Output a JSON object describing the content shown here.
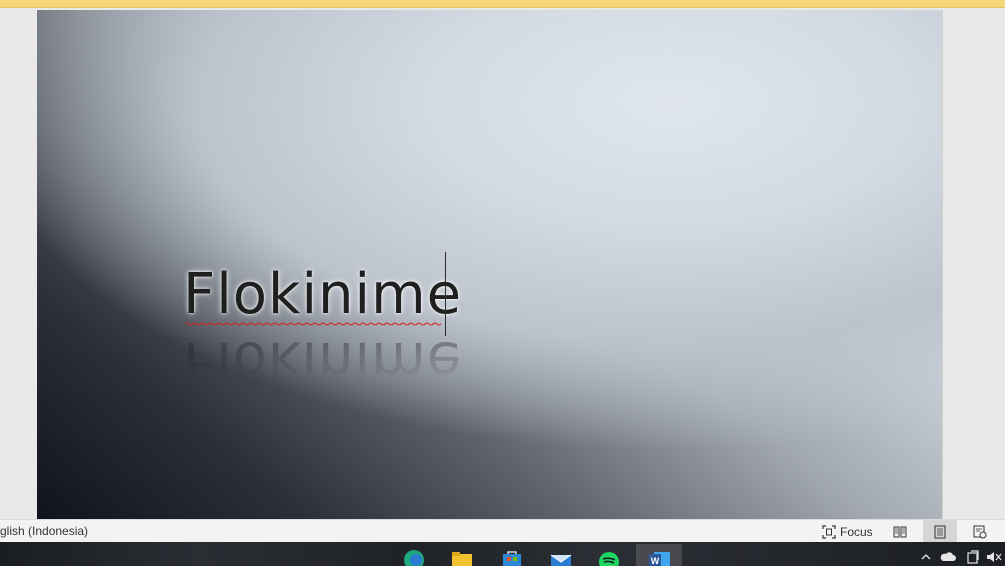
{
  "document": {
    "title_text": "Flokinime"
  },
  "status_bar": {
    "language": "glish (Indonesia)",
    "focus_label": "Focus",
    "views": [
      "read-mode",
      "print-layout",
      "web-layout"
    ],
    "active_view": "print-layout"
  },
  "taskbar": {
    "apps": [
      {
        "name": "edge-icon",
        "color": "#1ea97c"
      },
      {
        "name": "file-explorer-icon",
        "color": "#f2c12e"
      },
      {
        "name": "store-icon",
        "color": "#2b88d8"
      },
      {
        "name": "mail-icon",
        "color": "#2b7cd3"
      },
      {
        "name": "spotify-icon",
        "color": "#1ed760"
      },
      {
        "name": "word-icon",
        "color": "#2b579a"
      }
    ],
    "tray": [
      "chevron-up-icon",
      "onedrive-icon",
      "tablet-icon",
      "volume-icon"
    ]
  },
  "colors": {
    "accent_top": "#f5d77b",
    "spellcheck": "#d21f1f"
  }
}
